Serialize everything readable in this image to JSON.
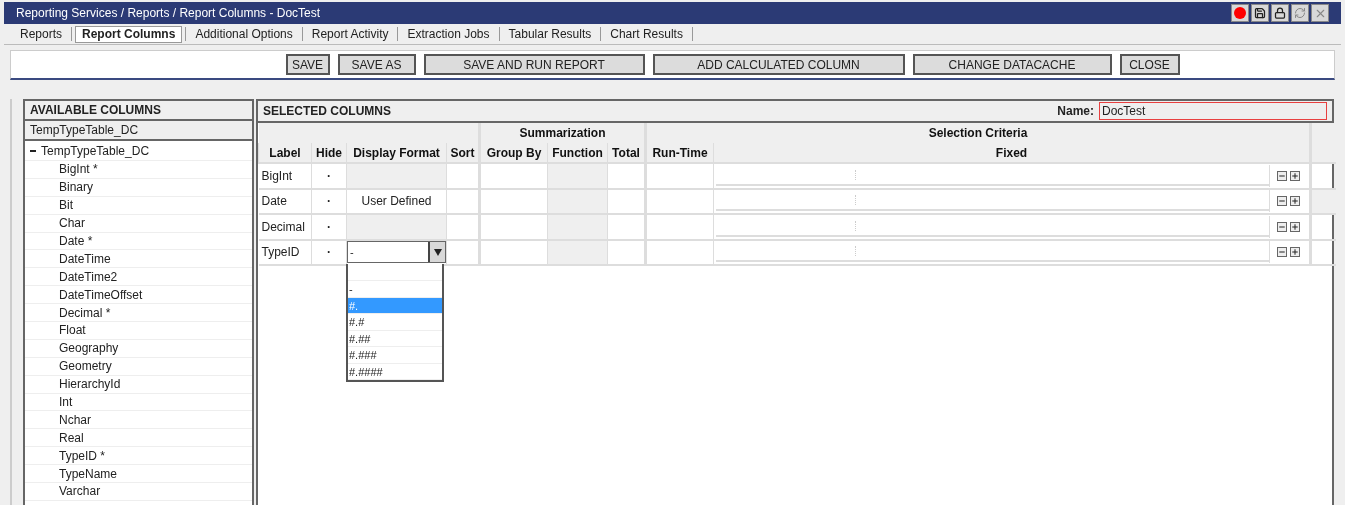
{
  "window": {
    "title": "Reporting Services / Reports / Report Columns - DocTest"
  },
  "tabs": [
    {
      "label": "Reports",
      "selected": false
    },
    {
      "label": "Report Columns",
      "selected": true
    },
    {
      "label": "Additional Options",
      "selected": false
    },
    {
      "label": "Report Activity",
      "selected": false
    },
    {
      "label": "Extraction Jobs",
      "selected": false
    },
    {
      "label": "Tabular Results",
      "selected": false
    },
    {
      "label": "Chart Results",
      "selected": false
    }
  ],
  "toolbar": [
    {
      "label": "SAVE"
    },
    {
      "label": "SAVE AS"
    },
    {
      "label": "SAVE AND RUN REPORT"
    },
    {
      "label": "ADD CALCULATED COLUMN"
    },
    {
      "label": "CHANGE DATACACHE"
    },
    {
      "label": "CLOSE"
    }
  ],
  "available_columns": {
    "title": "AVAILABLE COLUMNS",
    "source": "TempTypeTable_DC",
    "tree": {
      "label": "TempTypeTable_DC",
      "expanded": true,
      "children": [
        {
          "label": "BigInt *"
        },
        {
          "label": "Binary"
        },
        {
          "label": "Bit"
        },
        {
          "label": "Char"
        },
        {
          "label": "Date *"
        },
        {
          "label": "DateTime"
        },
        {
          "label": "DateTime2"
        },
        {
          "label": "DateTimeOffset"
        },
        {
          "label": "Decimal *"
        },
        {
          "label": "Float"
        },
        {
          "label": "Geography"
        },
        {
          "label": "Geometry"
        },
        {
          "label": "HierarchyId"
        },
        {
          "label": "Int"
        },
        {
          "label": "Nchar"
        },
        {
          "label": "Real"
        },
        {
          "label": "TypeID *"
        },
        {
          "label": "TypeName"
        },
        {
          "label": "Varchar"
        }
      ]
    }
  },
  "selected_columns": {
    "title": "SELECTED COLUMNS",
    "name_label": "Name:",
    "name_value": "DocTest",
    "group_headers": {
      "summarization": "Summarization",
      "selection_criteria": "Selection Criteria"
    },
    "columns": [
      "Label",
      "Hide",
      "Display Format",
      "Sort",
      "Group By",
      "Function",
      "Total",
      "Run-Time",
      "Fixed"
    ],
    "rows": [
      {
        "label": "BigInt",
        "hide": "·",
        "display_format": {
          "kind": "blank"
        }
      },
      {
        "label": "Date",
        "hide": "·",
        "display_format": {
          "kind": "text",
          "text": "User Defined"
        }
      },
      {
        "label": "Decimal",
        "hide": "·",
        "display_format": {
          "kind": "blank"
        }
      },
      {
        "label": "TypeID",
        "hide": "·",
        "display_format": {
          "kind": "select",
          "value": "-"
        }
      }
    ],
    "dropdown": {
      "open": true,
      "options": [
        {
          "label": "-",
          "selected": false
        },
        {
          "label": "#.",
          "selected": true
        },
        {
          "label": "#.#",
          "selected": false
        },
        {
          "label": "#.##",
          "selected": false
        },
        {
          "label": "#.###",
          "selected": false
        },
        {
          "label": "#.####",
          "selected": false
        }
      ]
    }
  }
}
